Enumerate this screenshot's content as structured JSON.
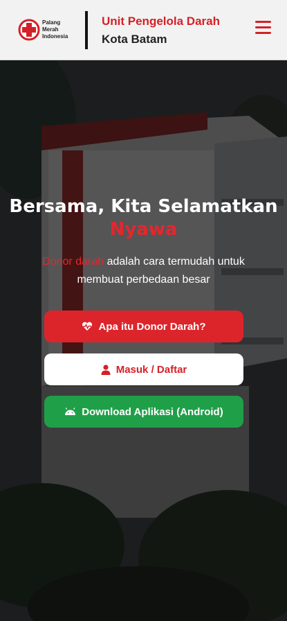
{
  "header": {
    "logo_lines": [
      "Palang",
      "Merah",
      "Indonesia"
    ],
    "title": "Unit Pengelola Darah",
    "subtitle": "Kota Batam",
    "menu_icon": "hamburger-menu-icon"
  },
  "hero": {
    "headline_line1": "Bersama, Kita Selamatkan",
    "headline_line2": "Nyawa",
    "desc_accent": "Donor darah",
    "desc_rest": " adalah cara termudah untuk membuat perbedaan besar",
    "buttons": {
      "about_label": "Apa itu Donor Darah?",
      "about_icon": "heart-pulse-icon",
      "login_label": "Masuk / Daftar",
      "login_icon": "user-icon",
      "download_label": "Download Aplikasi (Android)",
      "download_icon": "android-icon"
    }
  },
  "colors": {
    "brand_red": "#d42027",
    "accent_red": "#e5262d",
    "green": "#1fa048",
    "header_bg": "#f2f2f2"
  }
}
